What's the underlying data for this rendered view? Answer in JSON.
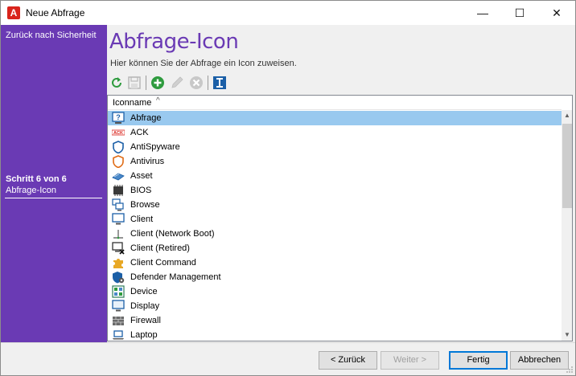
{
  "window": {
    "title": "Neue Abfrage",
    "app_icon_letter": "A",
    "minimize": "—",
    "maximize": "☐",
    "close": "✕"
  },
  "sidebar": {
    "back_link": "Zurück nach Sicherheit",
    "step": "Schritt 6 von 6",
    "current": "Abfrage-Icon"
  },
  "main": {
    "heading": "Abfrage-Icon",
    "subtitle": "Hier können Sie der Abfrage ein Icon zuweisen."
  },
  "toolbar": {
    "refresh": "refresh-icon",
    "save": "save-icon",
    "add": "add-icon",
    "edit": "edit-icon",
    "delete": "delete-icon",
    "info": "info-icon"
  },
  "list": {
    "column": "Iconname",
    "sort_indicator": "^",
    "items": [
      {
        "label": "Abfrage",
        "icon": "query-icon",
        "selected": true
      },
      {
        "label": "ACK",
        "icon": "ack-icon"
      },
      {
        "label": "AntiSpyware",
        "icon": "shield-icon"
      },
      {
        "label": "Antivirus",
        "icon": "shield-orange-icon"
      },
      {
        "label": "Asset",
        "icon": "asset-icon"
      },
      {
        "label": "BIOS",
        "icon": "chip-icon"
      },
      {
        "label": "Browse",
        "icon": "browse-icon"
      },
      {
        "label": "Client",
        "icon": "monitor-icon"
      },
      {
        "label": "Client (Network Boot)",
        "icon": "network-boot-icon"
      },
      {
        "label": "Client (Retired)",
        "icon": "monitor-retired-icon"
      },
      {
        "label": "Client Command",
        "icon": "puzzle-icon"
      },
      {
        "label": "Defender Management",
        "icon": "defender-icon"
      },
      {
        "label": "Device",
        "icon": "device-icon"
      },
      {
        "label": "Display",
        "icon": "display-icon"
      },
      {
        "label": "Firewall",
        "icon": "firewall-icon"
      },
      {
        "label": "Laptop",
        "icon": "laptop-icon"
      }
    ]
  },
  "buttons": {
    "back": "< Zurück",
    "next": "Weiter >",
    "finish": "Fertig",
    "cancel": "Abbrechen"
  },
  "colors": {
    "accent": "#6a3ab4",
    "selection": "#99c9ef",
    "brand_red": "#d9241c"
  }
}
